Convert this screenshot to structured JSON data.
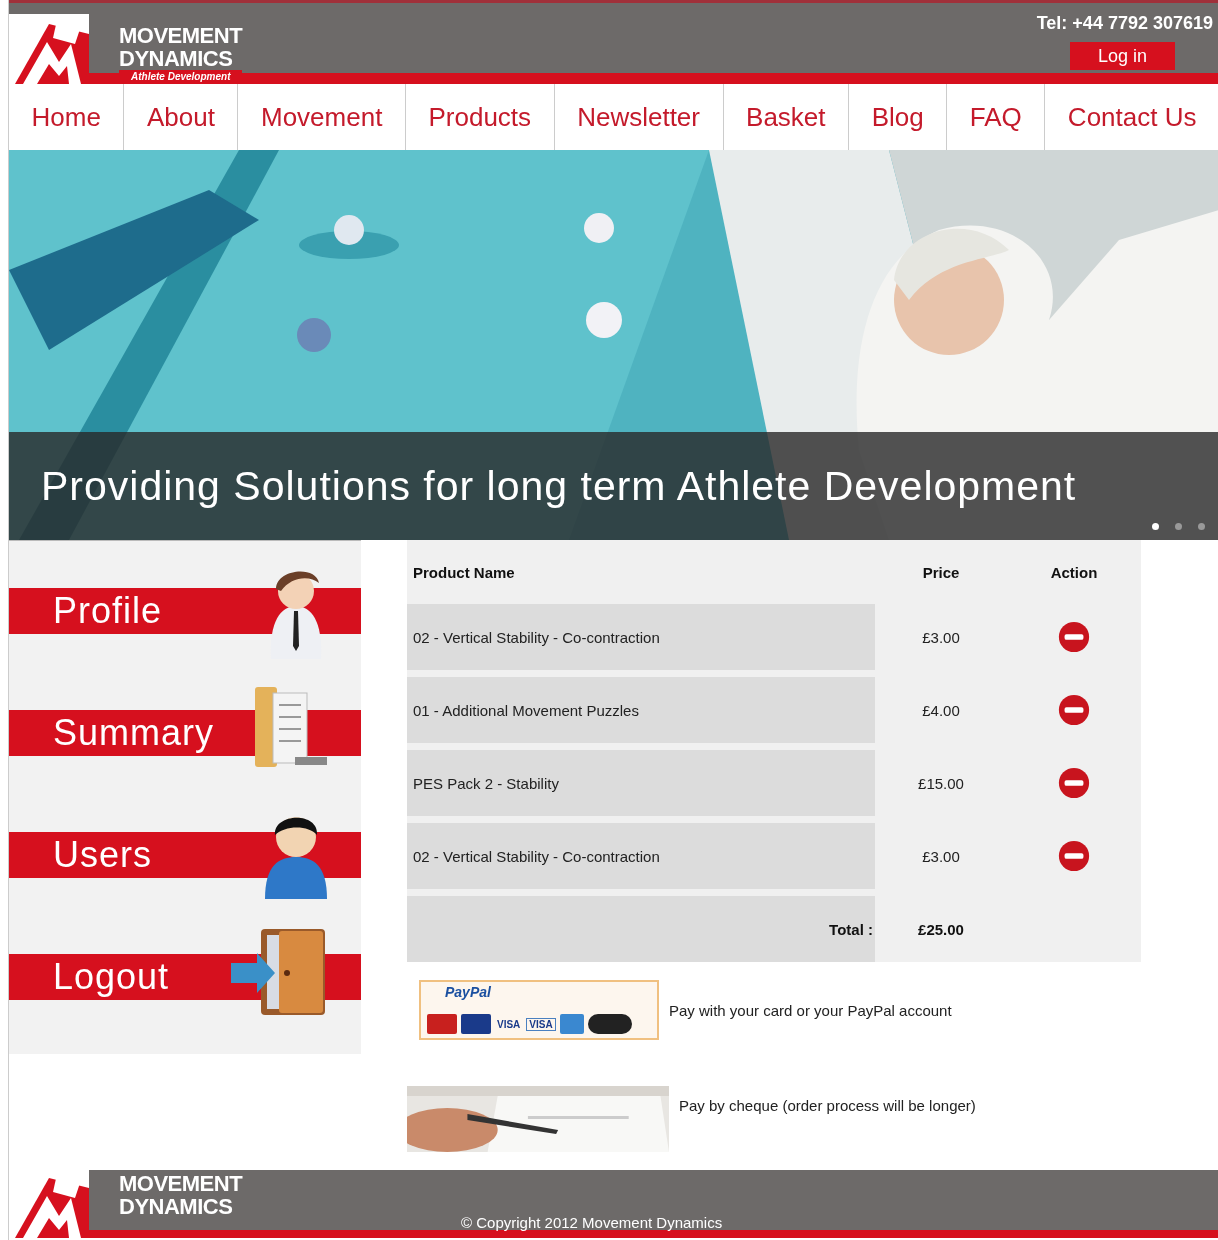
{
  "header": {
    "brand_line_1": "MOVEMENT",
    "brand_line_2": "DYNAMICS",
    "tagline": "Athlete Development",
    "phone": "Tel: +44 7792 307619",
    "login_button": "Log in"
  },
  "nav": [
    {
      "label": "Home"
    },
    {
      "label": "About"
    },
    {
      "label": "Movement"
    },
    {
      "label": "Products"
    },
    {
      "label": "Newsletter"
    },
    {
      "label": "Basket"
    },
    {
      "label": "Blog"
    },
    {
      "label": "FAQ"
    },
    {
      "label": "Contact Us"
    }
  ],
  "hero": {
    "caption": "Providing Solutions for long term Athlete Development",
    "slides": [
      {
        "selected": true
      },
      {
        "selected": false
      },
      {
        "selected": false
      }
    ]
  },
  "sidebar": {
    "items": [
      {
        "label": "Profile",
        "kind": "profile"
      },
      {
        "label": "Summary",
        "kind": "summary"
      },
      {
        "label": "Users",
        "kind": "users"
      },
      {
        "label": "Logout",
        "kind": "logout"
      }
    ]
  },
  "basket": {
    "columns": [
      "Product Name",
      "Price",
      "Action"
    ],
    "rows": [
      {
        "name": "02 - Vertical Stability - Co-contraction",
        "price": "£3.00"
      },
      {
        "name": "01 - Additional Movement Puzzles",
        "price": "£4.00"
      },
      {
        "name": "PES Pack 2 - Stability",
        "price": "£15.00"
      },
      {
        "name": "02 - Vertical Stability - Co-contraction",
        "price": "£3.00"
      }
    ],
    "total_label": "Total :",
    "total": "£25.00"
  },
  "payment": [
    {
      "kind": "paypal",
      "badge_title": "PayPal",
      "card_labels": [
        "VISA",
        "VISA"
      ],
      "text": "Pay with your card or your PayPal account"
    },
    {
      "kind": "cheque",
      "text": "Pay by cheque (order process will be longer)"
    }
  ],
  "footer": {
    "brand_line_1": "MOVEMENT",
    "brand_line_2": "DYNAMICS",
    "copyright": "© Copyright 2012 Movement Dynamics"
  }
}
